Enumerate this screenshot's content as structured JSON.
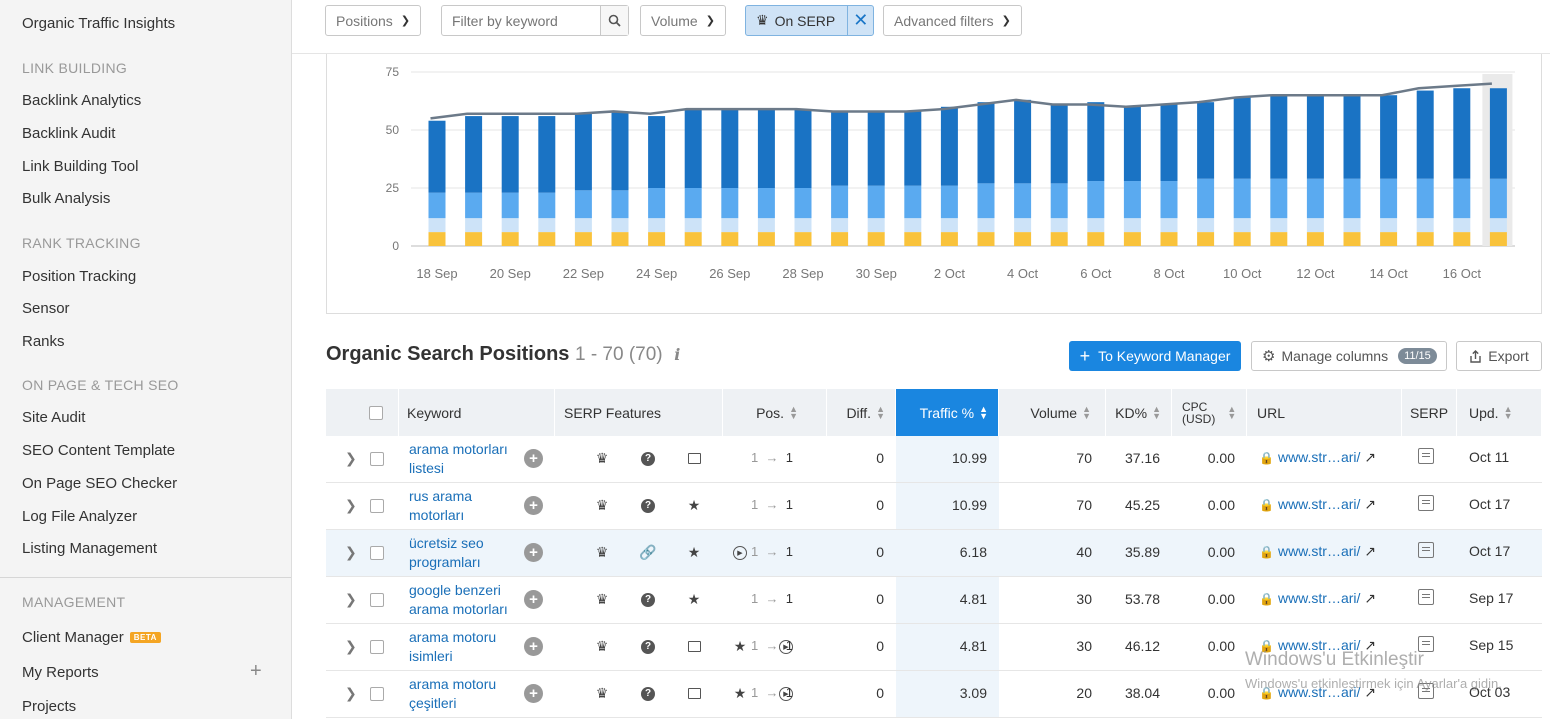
{
  "sidebar": {
    "top_item": "Organic Traffic Insights",
    "link_building": {
      "heading": "LINK BUILDING",
      "items": [
        "Backlink Analytics",
        "Backlink Audit",
        "Link Building Tool",
        "Bulk Analysis"
      ]
    },
    "rank_tracking": {
      "heading": "RANK TRACKING",
      "items": [
        "Position Tracking",
        "Sensor",
        "Ranks"
      ]
    },
    "on_page": {
      "heading": "ON PAGE & TECH SEO",
      "items": [
        "Site Audit",
        "SEO Content Template",
        "On Page SEO Checker",
        "Log File Analyzer",
        "Listing Management"
      ]
    },
    "management": {
      "heading": "MANAGEMENT",
      "client_manager": "Client Manager",
      "beta_badge": "BETA",
      "my_reports": "My Reports",
      "projects": "Projects"
    }
  },
  "filters": {
    "positions": "Positions",
    "keyword_placeholder": "Filter by keyword",
    "volume": "Volume",
    "on_serp": "On SERP",
    "advanced": "Advanced filters"
  },
  "chart_data": {
    "type": "bar",
    "categories": [
      "18 Sep",
      "19 Sep",
      "20 Sep",
      "21 Sep",
      "22 Sep",
      "23 Sep",
      "24 Sep",
      "25 Sep",
      "26 Sep",
      "27 Sep",
      "28 Sep",
      "29 Sep",
      "30 Sep",
      "1 Oct",
      "2 Oct",
      "3 Oct",
      "4 Oct",
      "5 Oct",
      "6 Oct",
      "7 Oct",
      "8 Oct",
      "9 Oct",
      "10 Oct",
      "11 Oct",
      "12 Oct",
      "13 Oct",
      "14 Oct",
      "15 Oct",
      "16 Oct",
      "17 Oct"
    ],
    "x_tick_labels": [
      "18 Sep",
      "20 Sep",
      "22 Sep",
      "24 Sep",
      "26 Sep",
      "28 Sep",
      "30 Sep",
      "2 Oct",
      "4 Oct",
      "6 Oct",
      "8 Oct",
      "10 Oct",
      "12 Oct",
      "14 Oct",
      "16 Oct"
    ],
    "y_ticks": [
      0,
      25,
      50,
      75
    ],
    "ylim": [
      0,
      75
    ],
    "stacked": true,
    "series": [
      {
        "color": "#f9c33c",
        "values": [
          6,
          6,
          6,
          6,
          6,
          6,
          6,
          6,
          6,
          6,
          6,
          6,
          6,
          6,
          6,
          6,
          6,
          6,
          6,
          6,
          6,
          6,
          6,
          6,
          6,
          6,
          6,
          6,
          6,
          6
        ]
      },
      {
        "color": "#cde3f8",
        "values": [
          6,
          6,
          6,
          6,
          6,
          6,
          6,
          6,
          6,
          6,
          6,
          6,
          6,
          6,
          6,
          6,
          6,
          6,
          6,
          6,
          6,
          6,
          6,
          6,
          6,
          6,
          6,
          6,
          6,
          6
        ]
      },
      {
        "color": "#5aaaf0",
        "values": [
          11,
          11,
          11,
          11,
          12,
          12,
          13,
          13,
          13,
          13,
          13,
          14,
          14,
          14,
          14,
          15,
          15,
          15,
          16,
          16,
          16,
          17,
          17,
          17,
          17,
          17,
          17,
          17,
          17,
          17
        ]
      },
      {
        "color": "#1a73c4",
        "values": [
          31,
          33,
          33,
          33,
          33,
          34,
          31,
          34,
          34,
          34,
          34,
          32,
          32,
          32,
          34,
          35,
          36,
          34,
          34,
          32,
          33,
          33,
          35,
          36,
          36,
          36,
          36,
          38,
          39,
          39
        ]
      }
    ],
    "line": {
      "color": "#6c7a89",
      "values": [
        55,
        57,
        57,
        57,
        57,
        58,
        57,
        59,
        59,
        59,
        59,
        58,
        58,
        58,
        59,
        61,
        63,
        61,
        61,
        60,
        61,
        62,
        64,
        65,
        65,
        65,
        65,
        68,
        69,
        70
      ]
    }
  },
  "section": {
    "title": "Organic Search Positions",
    "count": "1 - 70 (70)",
    "info": "i",
    "to_keyword_manager": "To Keyword Manager",
    "manage_columns": "Manage columns",
    "columns_badge": "11/15",
    "export": "Export"
  },
  "table": {
    "headers": {
      "keyword": "Keyword",
      "serp_features": "SERP Features",
      "pos": "Pos.",
      "diff": "Diff.",
      "traffic": "Traffic %",
      "volume": "Volume",
      "kd": "KD%",
      "cpc_line1": "CPC",
      "cpc_line2": "(USD)",
      "url": "URL",
      "serp": "SERP",
      "upd": "Upd."
    },
    "rows": [
      {
        "keyword": "arama motorları listesi",
        "serp": [
          "crown-icon",
          "question-icon",
          "image-icon"
        ],
        "pos_from": "1",
        "pos_to": "1",
        "diff": "0",
        "traffic": "10.99",
        "volume": "70",
        "kd": "37.16",
        "cpc": "0.00",
        "url": "www.str…ari/",
        "upd": "Oct 11"
      },
      {
        "keyword": "rus arama motorları",
        "serp": [
          "crown-icon",
          "question-icon",
          "star-icon"
        ],
        "pos_from": "1",
        "pos_to": "1",
        "diff": "0",
        "traffic": "10.99",
        "volume": "70",
        "kd": "45.25",
        "cpc": "0.00",
        "url": "www.str…ari/",
        "upd": "Oct 17"
      },
      {
        "keyword": "ücretsiz seo programları",
        "serp": [
          "crown-icon",
          "link-icon",
          "star-icon",
          "play-icon"
        ],
        "pos_from": "1",
        "pos_to": "1",
        "diff": "0",
        "traffic": "6.18",
        "volume": "40",
        "kd": "35.89",
        "cpc": "0.00",
        "url": "www.str…ari/",
        "upd": "Oct 17"
      },
      {
        "keyword": "google benzeri arama motorları",
        "serp": [
          "crown-icon",
          "question-icon",
          "star-icon"
        ],
        "pos_from": "1",
        "pos_to": "1",
        "diff": "0",
        "traffic": "4.81",
        "volume": "30",
        "kd": "53.78",
        "cpc": "0.00",
        "url": "www.str…ari/",
        "upd": "Sep 17"
      },
      {
        "keyword": "arama motoru isimleri",
        "serp": [
          "crown-icon",
          "question-icon",
          "image-icon",
          "star-icon",
          "play-icon"
        ],
        "pos_from": "1",
        "pos_to": "1",
        "diff": "0",
        "traffic": "4.81",
        "volume": "30",
        "kd": "46.12",
        "cpc": "0.00",
        "url": "www.str…ari/",
        "upd": "Sep 15"
      },
      {
        "keyword": "arama motoru çeşitleri",
        "serp": [
          "crown-icon",
          "question-icon",
          "image-icon",
          "star-icon",
          "play-icon"
        ],
        "pos_from": "1",
        "pos_to": "1",
        "diff": "0",
        "traffic": "3.09",
        "volume": "20",
        "kd": "38.04",
        "cpc": "0.00",
        "url": "www.str…ari/",
        "upd": "Oct 03"
      }
    ]
  },
  "watermark": {
    "line1": "Windows'u Etkinleştir",
    "line2": "Windows'u etkinleştirmek için Ayarlar'a gidin."
  }
}
